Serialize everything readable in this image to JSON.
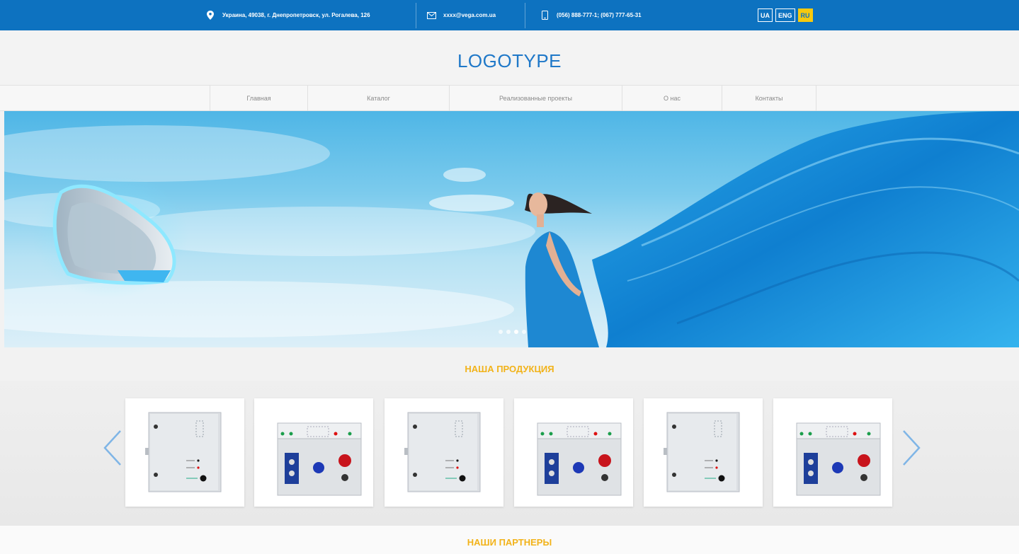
{
  "topbar": {
    "address": "Украина, 49038, г. Днепропетровск, ул. Рогалева, 126",
    "email": "xxxx@vega.com.ua",
    "phone": "(056) 888-777-1; (067) 777-65-31",
    "languages": [
      {
        "code": "UA",
        "active": false
      },
      {
        "code": "ENG",
        "active": false
      },
      {
        "code": "RU",
        "active": true
      }
    ],
    "bar_color": "#0d72c0",
    "active_lang_color": "#f6c90e"
  },
  "header": {
    "logo": "LOGOTYPE",
    "logo_color": "#1f78c8"
  },
  "nav": {
    "items": [
      {
        "label": "Главная"
      },
      {
        "label": "Каталог"
      },
      {
        "label": "Реализованные проекты"
      },
      {
        "label": "О нас"
      },
      {
        "label": "Контакты"
      }
    ]
  },
  "hero": {
    "slides_count": 4,
    "active_slide": 3
  },
  "products": {
    "title": "НАША ПРОДУКЦИЯ",
    "items": [
      {
        "kind": "enclosure-cabinet"
      },
      {
        "kind": "control-panel"
      },
      {
        "kind": "enclosure-cabinet"
      },
      {
        "kind": "control-panel"
      },
      {
        "kind": "enclosure-cabinet"
      },
      {
        "kind": "control-panel"
      }
    ],
    "prev_icon": "chevron-left-icon",
    "next_icon": "chevron-right-icon",
    "title_color": "#f2b31a"
  },
  "partners": {
    "title": "НАШИ ПАРТНЕРЫ"
  }
}
